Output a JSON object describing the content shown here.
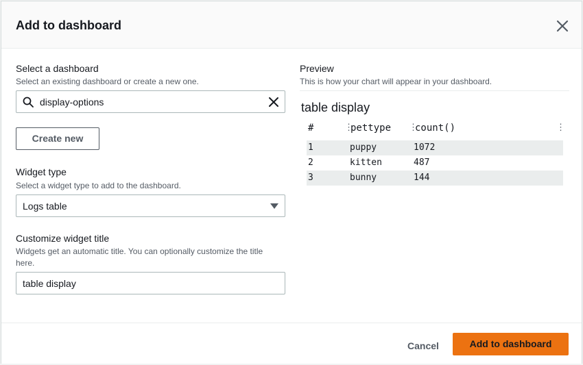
{
  "modal": {
    "title": "Add to dashboard"
  },
  "select_dashboard": {
    "label": "Select a dashboard",
    "description": "Select an existing dashboard or create a new one.",
    "search_value": "display-options",
    "create_new_label": "Create new"
  },
  "widget_type": {
    "label": "Widget type",
    "description": "Select a widget type to add to the dashboard.",
    "selected": "Logs table"
  },
  "widget_title": {
    "label": "Customize widget title",
    "description_line1": "Widgets get an automatic title. You can optionally customize the title",
    "description_line2": "here.",
    "value": "table display"
  },
  "preview": {
    "label": "Preview",
    "description": "This is how your chart will appear in your dashboard.",
    "title": "table display",
    "columns": [
      "#",
      "pettype",
      "count()"
    ],
    "rows": [
      {
        "index": "1",
        "pettype": "puppy",
        "count": "1072"
      },
      {
        "index": "2",
        "pettype": "kitten",
        "count": "487"
      },
      {
        "index": "3",
        "pettype": "bunny",
        "count": "144"
      }
    ]
  },
  "footer": {
    "cancel_label": "Cancel",
    "submit_label": "Add to dashboard"
  },
  "colors": {
    "primary": "#ec7211",
    "text": "#16191f",
    "secondary_text": "#545b64",
    "border": "#aab7b8",
    "row_alt": "#eaeded"
  },
  "icons": {
    "close": "close-icon",
    "search": "search-icon",
    "clear": "clear-icon",
    "dropdown": "caret-down-icon",
    "column_menu": "column-menu-icon"
  }
}
